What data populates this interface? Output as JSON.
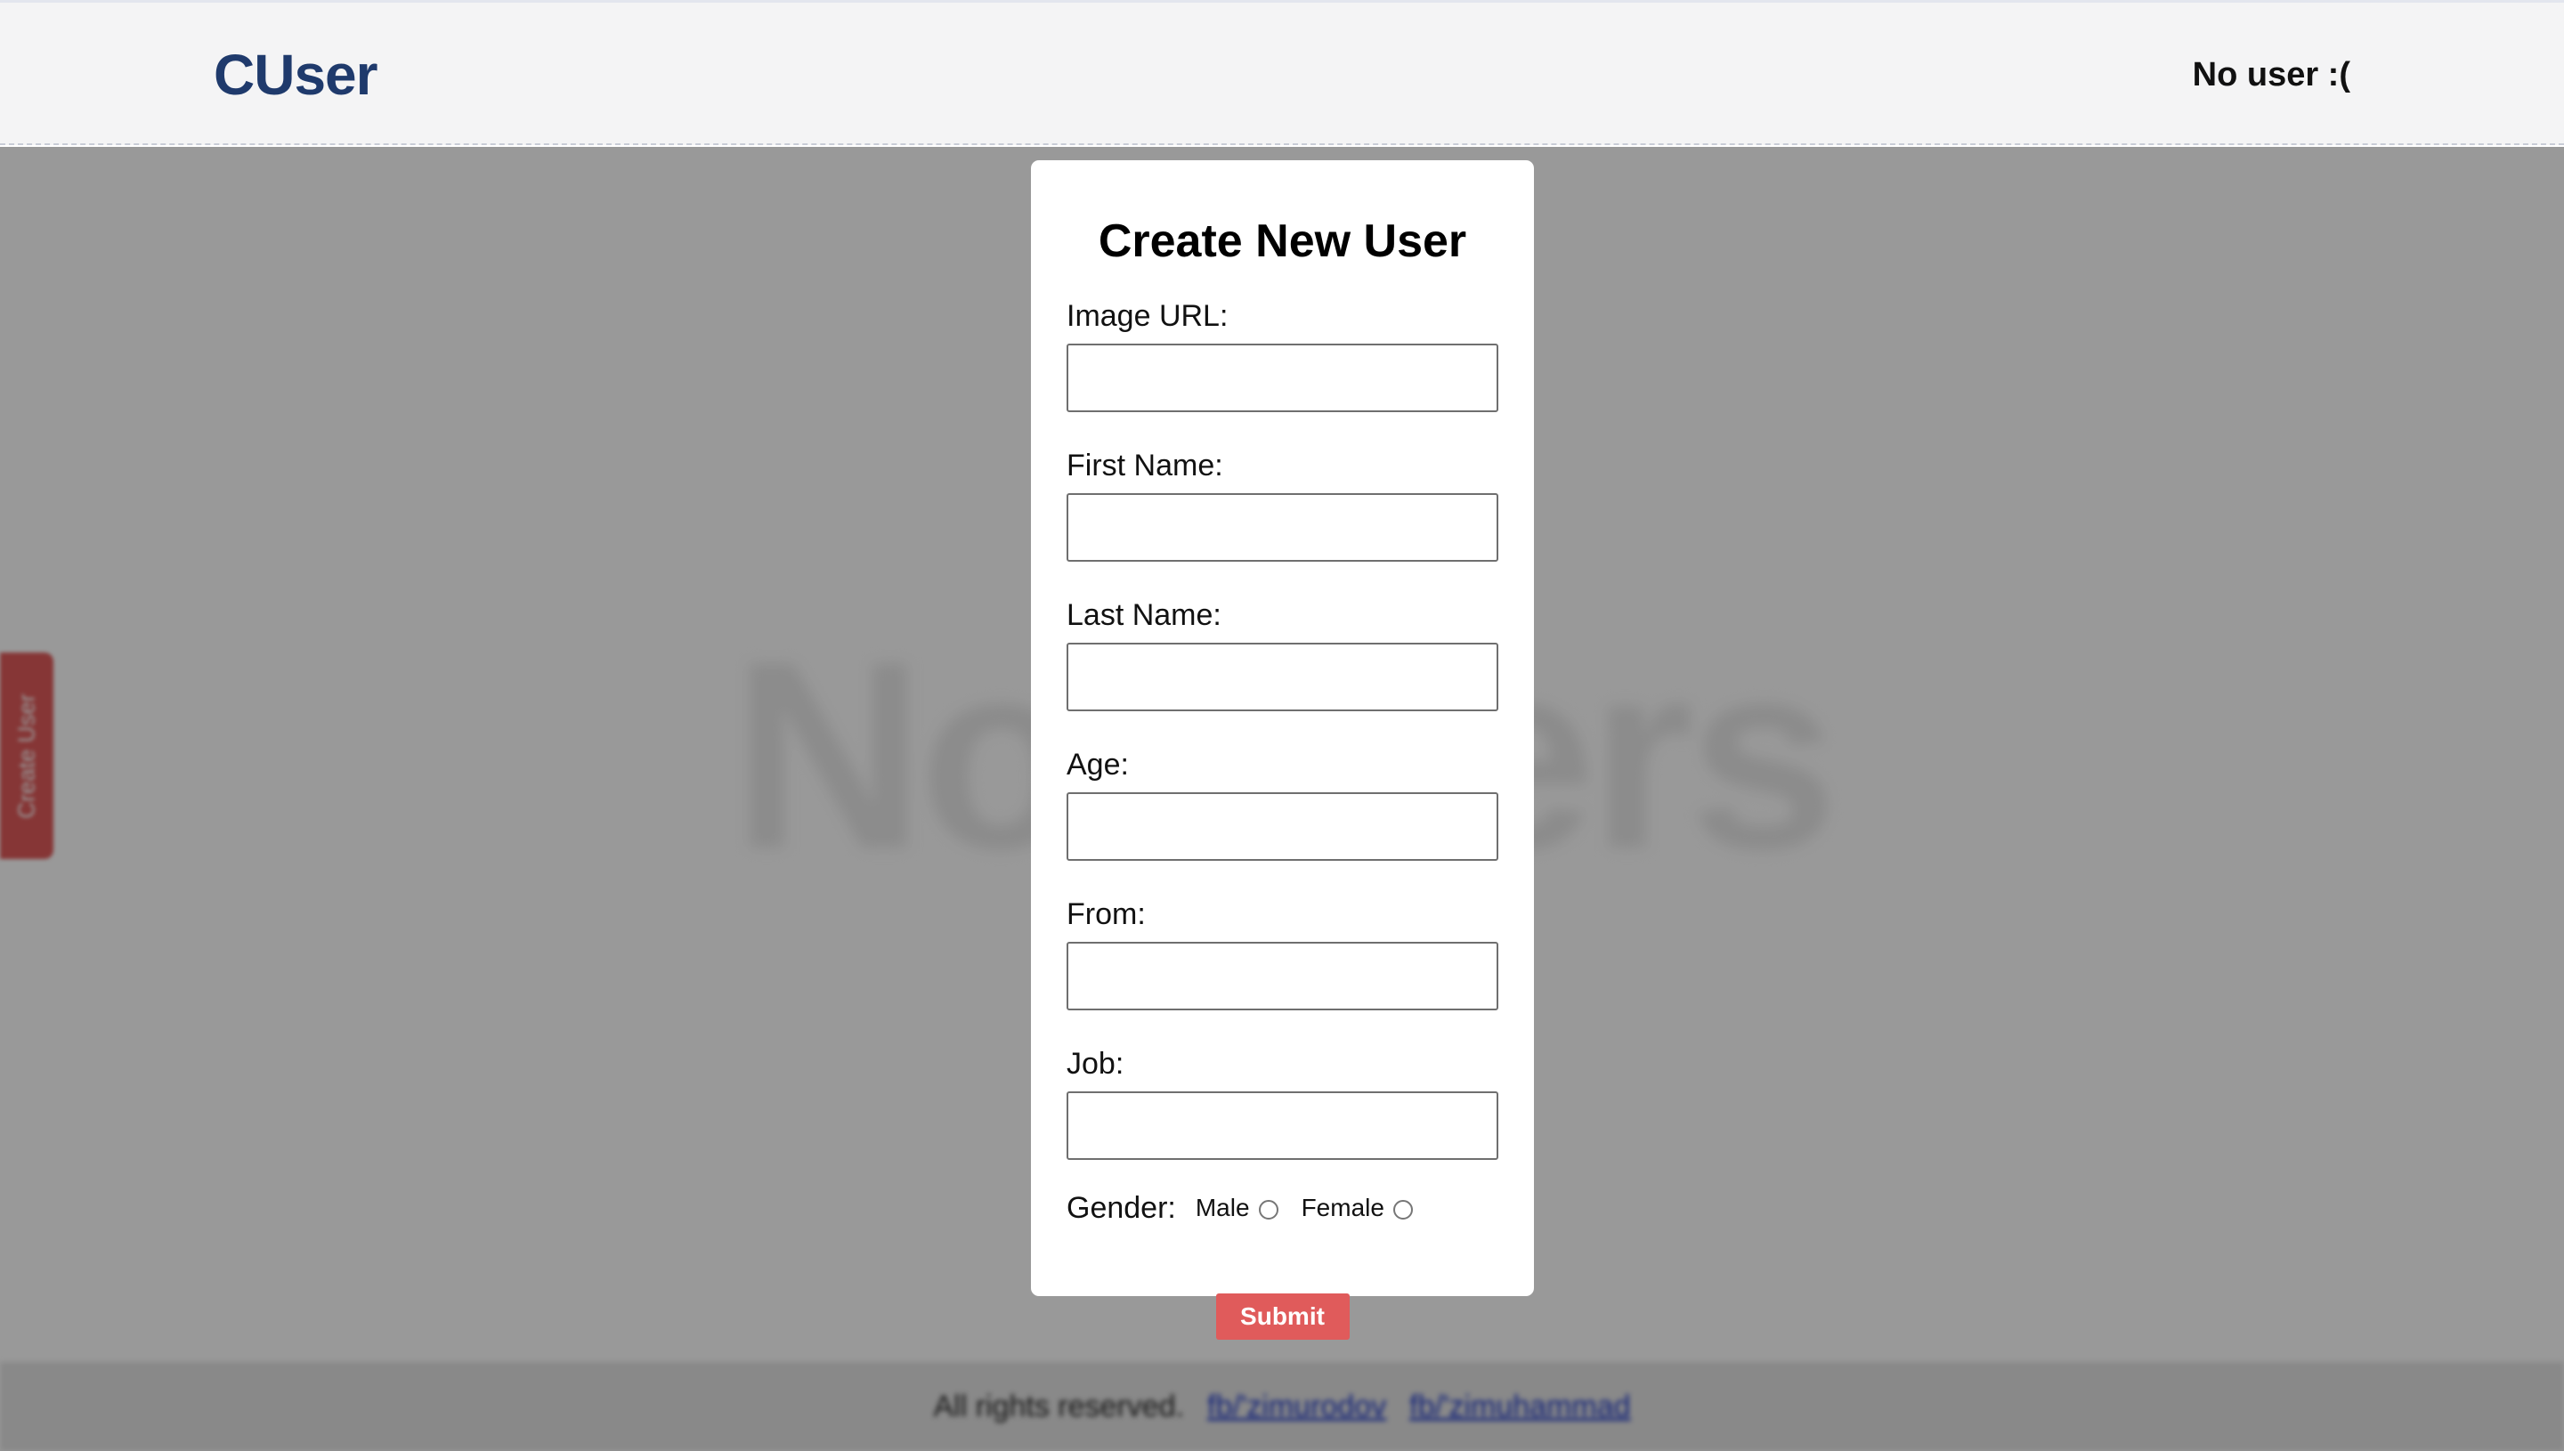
{
  "header": {
    "logo": "CUser",
    "user_status": "No user :("
  },
  "main": {
    "empty_heading": "No users",
    "side_tab_label": "Create User"
  },
  "footer": {
    "rights": "All rights reserved.",
    "links": [
      "fb/'zimurodov",
      "fb/'zimuhammad"
    ]
  },
  "modal": {
    "title": "Create New User",
    "fields": {
      "image_url": {
        "label": "Image URL:",
        "value": ""
      },
      "first_name": {
        "label": "First Name:",
        "value": ""
      },
      "last_name": {
        "label": "Last Name:",
        "value": ""
      },
      "age": {
        "label": "Age:",
        "value": ""
      },
      "from": {
        "label": "From:",
        "value": ""
      },
      "job": {
        "label": "Job:",
        "value": ""
      }
    },
    "gender": {
      "label": "Gender:",
      "options": [
        "Male",
        "Female"
      ],
      "selected": null
    },
    "submit_label": "Submit"
  },
  "colors": {
    "brand": "#1f3a6c",
    "accent": "#e05b5b",
    "overlay": "rgba(0,0,0,0.40)"
  }
}
